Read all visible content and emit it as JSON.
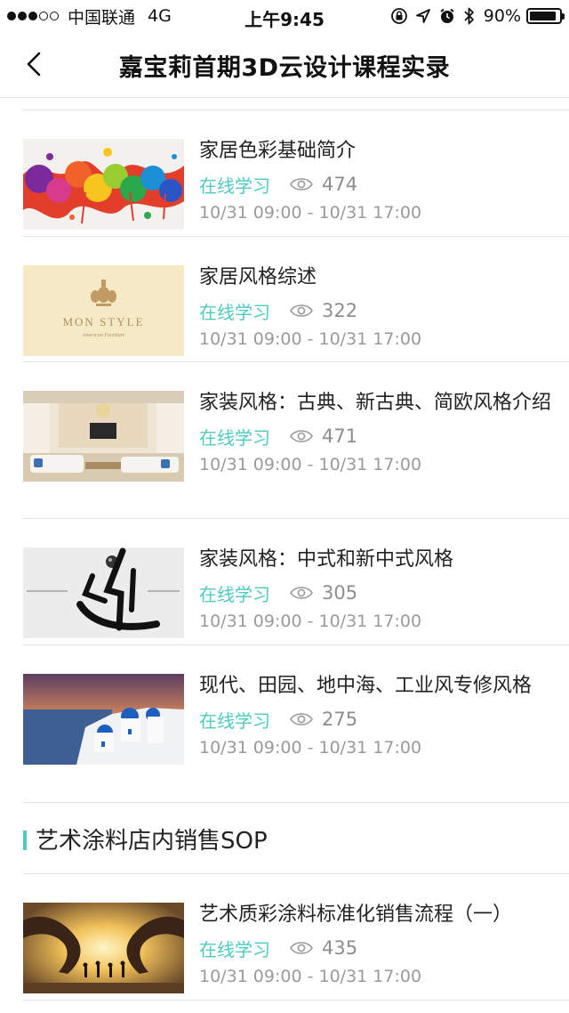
{
  "status_bar": {
    "carrier": "中国联通",
    "network": "4G",
    "time": "上午9:45",
    "battery_text": "90%",
    "battery_level": 0.9,
    "signal_bars_filled": 3,
    "signal_bars_total": 5,
    "icons": [
      "lock-rotation-icon",
      "location-icon",
      "alarm-icon",
      "bluetooth-icon",
      "battery-icon"
    ]
  },
  "nav": {
    "back_icon": "chevron-left-icon",
    "title": "嘉宝莉首期3D云设计课程实录"
  },
  "courses": [
    {
      "title": "家居色彩基础简介",
      "mode": "在线学习",
      "views": "474",
      "time": "10/31 09:00 - 10/31 17:00",
      "thumbnail": "paint-splash-image"
    },
    {
      "title": "家居风格综述",
      "mode": "在线学习",
      "views": "322",
      "time": "10/31 09:00 - 10/31 17:00",
      "thumbnail": "mon-style-logo-image",
      "thumbnail_text": "MON STYLE",
      "thumbnail_subtext": "American Furniture"
    },
    {
      "title": "家装风格：古典、新古典、简欧风格介绍",
      "mode": "在线学习",
      "views": "471",
      "time": "10/31 09:00 - 10/31 17:00",
      "thumbnail": "european-living-room-image"
    },
    {
      "title": "家装风格：中式和新中式风格",
      "mode": "在线学习",
      "views": "305",
      "time": "10/31 09:00 - 10/31 17:00",
      "thumbnail": "chinese-calligraphy-image"
    },
    {
      "title": "现代、田园、地中海、工业风专修风格",
      "mode": "在线学习",
      "views": "275",
      "time": "10/31 09:00 - 10/31 17:00",
      "thumbnail": "santorini-image"
    },
    {
      "title": "艺术质彩涂料标准化销售流程（一）",
      "mode": "在线学习",
      "views": "435",
      "time": "10/31 09:00 - 10/31 17:00",
      "thumbnail": "hands-sunset-image"
    }
  ],
  "section": {
    "title": "艺术涂料店内销售SOP"
  },
  "colors": {
    "accent": "#4ecbc0",
    "meta_gray": "#9a9a9a",
    "divider": "#e4e4e4"
  }
}
